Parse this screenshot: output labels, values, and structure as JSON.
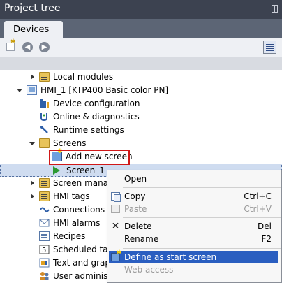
{
  "panel": {
    "title": "Project tree",
    "tab_label": "Devices"
  },
  "tree": {
    "items": [
      {
        "label": "Local modules",
        "icon": "folder-icon"
      },
      {
        "label": "HMI_1 [KTP400 Basic color PN]",
        "icon": "hmi-device-icon"
      },
      {
        "label": "Device configuration",
        "icon": "device-config-icon"
      },
      {
        "label": "Online & diagnostics",
        "icon": "online-diagnostics-icon"
      },
      {
        "label": "Runtime settings",
        "icon": "runtime-settings-icon"
      },
      {
        "label": "Screens",
        "icon": "folder-icon"
      },
      {
        "label": "Add new screen",
        "icon": "add-screen-icon"
      },
      {
        "label": "Screen_1",
        "icon": "screen-play-icon"
      },
      {
        "label": "Screen manag",
        "icon": "folder-icon"
      },
      {
        "label": "HMI tags",
        "icon": "folder-icon"
      },
      {
        "label": "Connections",
        "icon": "connections-icon"
      },
      {
        "label": "HMI alarms",
        "icon": "alarms-icon"
      },
      {
        "label": "Recipes",
        "icon": "recipes-icon"
      },
      {
        "label": "Scheduled tas",
        "icon": "scheduled-tasks-icon"
      },
      {
        "label": "Text and grapl",
        "icon": "text-graphics-icon"
      },
      {
        "label": "User administ",
        "icon": "user-admin-icon"
      }
    ]
  },
  "context_menu": {
    "open": "Open",
    "copy": "Copy",
    "copy_shortcut": "Ctrl+C",
    "paste": "Paste",
    "paste_shortcut": "Ctrl+V",
    "delete": "Delete",
    "delete_shortcut": "Del",
    "rename": "Rename",
    "rename_shortcut": "F2",
    "define_start": "Define as start screen",
    "web_access": "Web access"
  },
  "colors": {
    "titlebar": "#3c4250",
    "tabbar": "#5c6575",
    "highlight_box": "#d01818",
    "menu_active": "#2a5ec0"
  }
}
